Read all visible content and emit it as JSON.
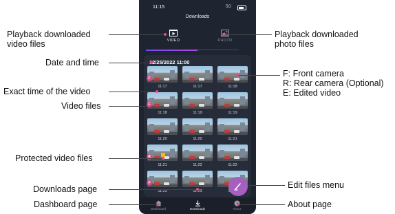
{
  "phone": {
    "status_time": "11:15",
    "status_signal": "5G",
    "title": "Downloads",
    "tabs": [
      {
        "label": "VIDEO",
        "icon": "video-file-icon",
        "active": true
      },
      {
        "label": "PHOTO",
        "icon": "photo-file-icon",
        "active": false
      }
    ],
    "datetime": "12/25/2022 11:00",
    "thumbnails": [
      {
        "time": "11:17",
        "badge": "F",
        "protected": false
      },
      {
        "time": "11:17",
        "badge": "",
        "protected": false
      },
      {
        "time": "11:18",
        "badge": "",
        "protected": false
      },
      {
        "time": "11:18",
        "badge": "F",
        "protected": false
      },
      {
        "time": "11:19",
        "badge": "",
        "protected": false
      },
      {
        "time": "11:19",
        "badge": "",
        "protected": false
      },
      {
        "time": "11:20",
        "badge": "",
        "protected": false
      },
      {
        "time": "11:20",
        "badge": "",
        "protected": false
      },
      {
        "time": "11:21",
        "badge": "",
        "protected": false
      },
      {
        "time": "11:21",
        "badge": "R",
        "protected": true
      },
      {
        "time": "11:22",
        "badge": "",
        "protected": false
      },
      {
        "time": "11:22",
        "badge": "",
        "protected": false
      },
      {
        "time": "11:23",
        "badge": "F",
        "protected": false
      },
      {
        "time": "11:23",
        "badge": "",
        "protected": false
      },
      {
        "time": "11:24",
        "badge": "",
        "protected": false
      }
    ],
    "nav": [
      {
        "label": "Dashboard",
        "icon": "home-icon",
        "active": false
      },
      {
        "label": "Downloads",
        "icon": "download-icon",
        "active": true
      },
      {
        "label": "About",
        "icon": "info-icon",
        "active": false
      }
    ],
    "fab_icon": "pencil-icon"
  },
  "callouts": {
    "playback_video": "Playback downloaded\nvideo files",
    "playback_photo": "Playback downloaded\nphoto files",
    "date_time": "Date and time",
    "camera_legend": "F: Front camera\nR: Rear camera (Optional)\nE: Edited video",
    "exact_time": "Exact time of the video",
    "video_files": "Video files",
    "protected": "Protected video files",
    "edit_menu": "Edit files menu",
    "downloads_page": "Downloads page",
    "dashboard_page": "Dashboard page",
    "about_page": "About page"
  },
  "colors": {
    "phone_bg": "#1e2430",
    "panel_bg": "#262c39",
    "accent": "#a55fbf",
    "badge": "#d84a8a",
    "callout_dot": "#e74a8f"
  }
}
